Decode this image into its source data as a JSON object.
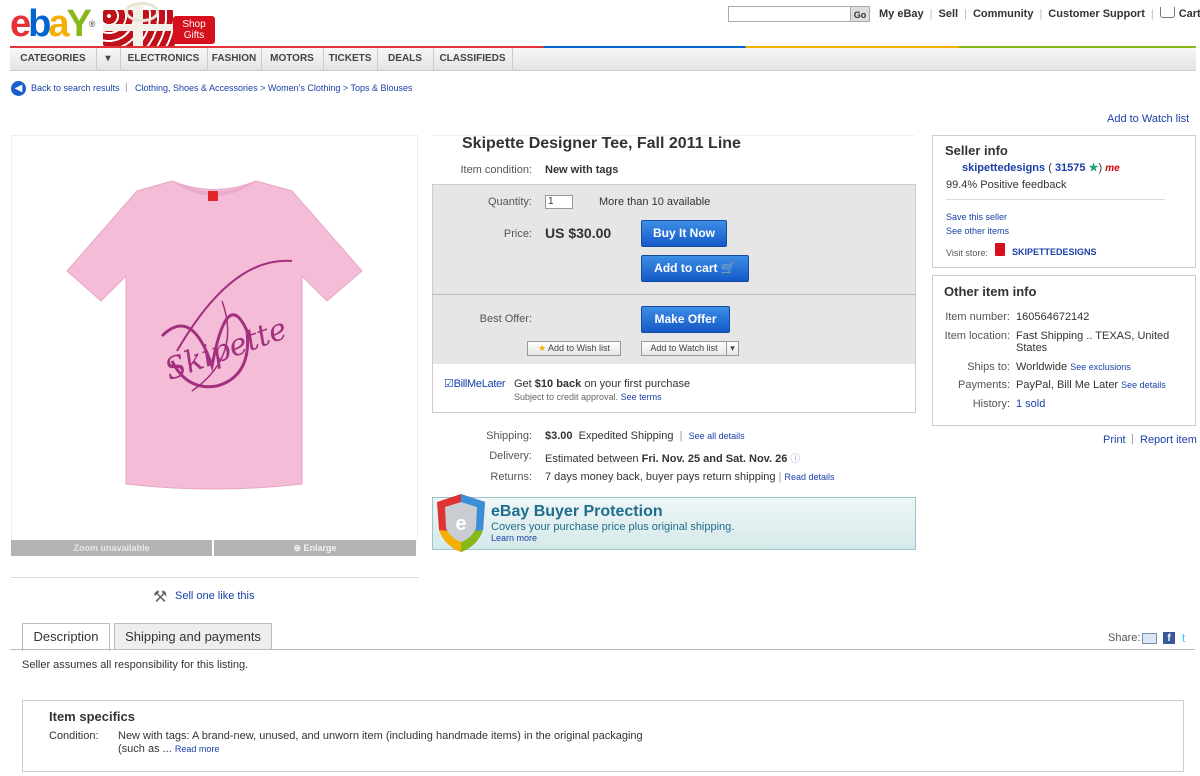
{
  "header": {
    "logo": {
      "e": "e",
      "b": "b",
      "a": "a",
      "y": "Y",
      "mark": "®"
    },
    "gift_label": "Shop Gifts",
    "search_go": "Go",
    "toplinks": [
      "My eBay",
      "Sell",
      "Community",
      "Customer Support",
      "Cart"
    ]
  },
  "nav": [
    "CATEGORIES",
    "ELECTRONICS",
    "FASHION",
    "MOTORS",
    "TICKETS",
    "DEALS",
    "CLASSIFIEDS"
  ],
  "breadcrumb": {
    "back": "Back to search results",
    "path": "Clothing, Shoes & Accessories > Women's Clothing > Tops & Blouses"
  },
  "watch_top": "Add to Watch list",
  "image": {
    "zoom": "Zoom unavailable",
    "enlarge": "Enlarge",
    "logo_text": "Skipette"
  },
  "sell_one": "Sell one like this",
  "item": {
    "title": "Skipette Designer Tee, Fall 2011 Line",
    "condition_label": "Item condition:",
    "condition": "New with tags",
    "quantity_label": "Quantity:",
    "quantity": "1",
    "available": "More than 10 available",
    "price_label": "Price:",
    "price": "US $30.00",
    "buy_now": "Buy It Now",
    "add_to_cart": "Add to cart",
    "best_offer_label": "Best Offer:",
    "make_offer": "Make Offer",
    "add_wish": "Add to Wish list",
    "add_watch": "Add to Watch list",
    "bml_logo": "BillMeLater",
    "bml_text_a": "Get ",
    "bml_bold": "$10 back",
    "bml_text_b": " on your first purchase",
    "bml_sub": "Subject to credit approval.",
    "see_terms": "See terms",
    "shipping_label": "Shipping:",
    "shipping_cost": "$3.00",
    "shipping_method": "Expedited Shipping",
    "see_all": "See all details",
    "delivery_label": "Delivery:",
    "delivery_text": "Estimated between ",
    "delivery_dates": "Fri. Nov. 25 and Sat. Nov. 26",
    "returns_label": "Returns:",
    "returns_text": "7 days money back, buyer pays return shipping",
    "read_details": "Read details"
  },
  "protection": {
    "title": "eBay Buyer Protection",
    "text": "Covers your purchase price plus original shipping.",
    "learn": "Learn more"
  },
  "seller": {
    "title": "Seller info",
    "name": "skipettedesigns",
    "score": "31575",
    "feedback": "99.4% Positive feedback",
    "save": "Save this seller",
    "see_other": "See other items",
    "visit_label": "Visit store:",
    "store": "SKIPETTEDESIGNS"
  },
  "other": {
    "title": "Other item info",
    "number_label": "Item number:",
    "number": "160564672142",
    "location_label": "Item location:",
    "location": "Fast Shipping .. TEXAS, United States",
    "ships_label": "Ships to:",
    "ships": "Worldwide",
    "ships_link": "See exclusions",
    "payments_label": "Payments:",
    "payments": "PayPal, Bill Me Later",
    "payments_link": "See details",
    "history_label": "History:",
    "history": "1 sold"
  },
  "print": "Print",
  "report": "Report item",
  "tabs": [
    "Description",
    "Shipping and payments"
  ],
  "share": "Share:",
  "description": "Seller assumes all responsibility for this listing.",
  "specifics": {
    "title": "Item specifics",
    "condition_label": "Condition:",
    "condition_text": "New with tags: A brand-new, unused, and unworn item (including handmade items) in the original packaging",
    "condition_text2": "(such as ... ",
    "read_more": "Read more"
  },
  "colors": {
    "accent": "#1a3fa8",
    "button": "#1559c8",
    "tee": "#f4bcd6",
    "logo_ink": "#a2307e"
  }
}
